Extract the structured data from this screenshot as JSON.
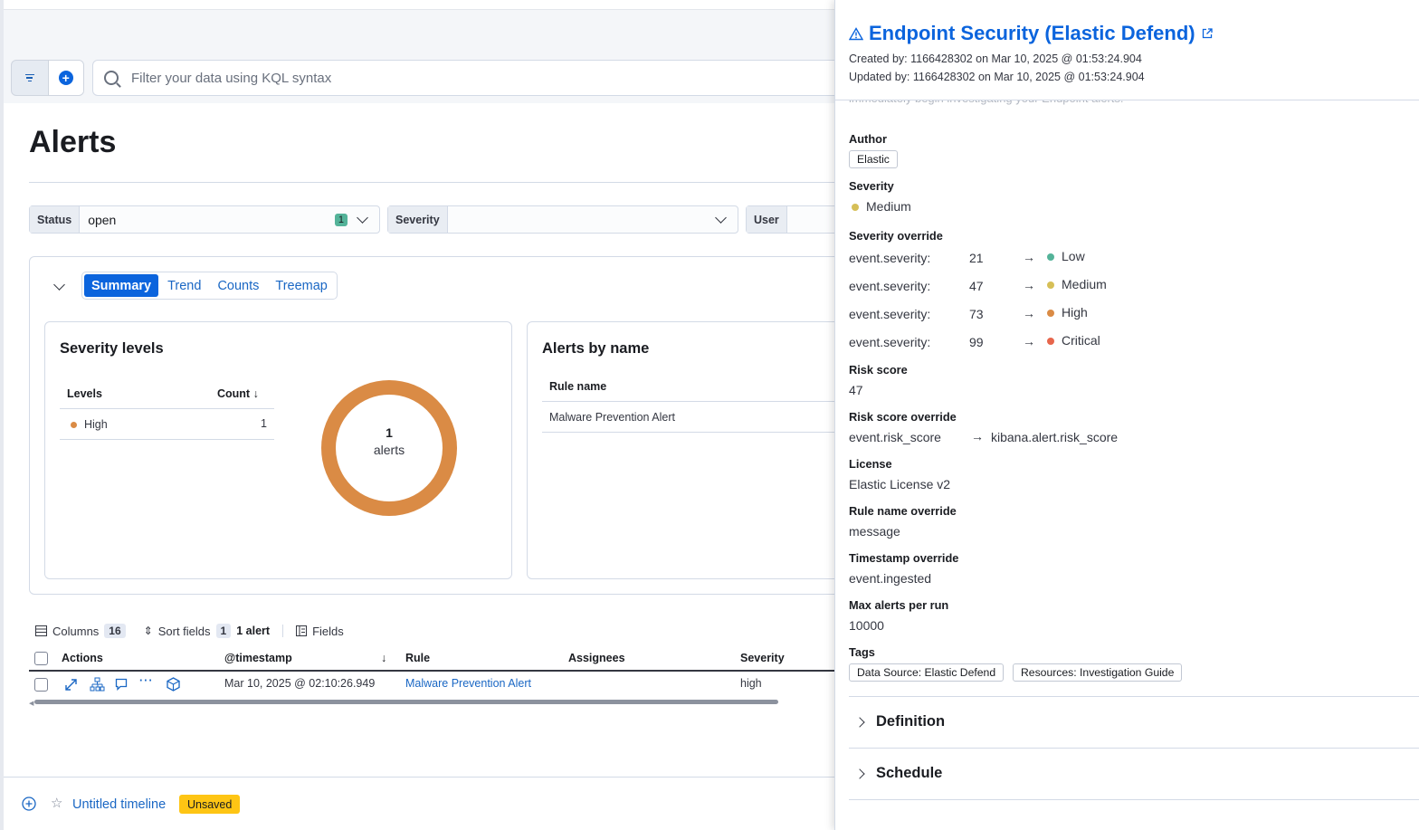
{
  "query": {
    "placeholder": "Filter your data using KQL syntax"
  },
  "page": {
    "title": "Alerts"
  },
  "controls": {
    "status": {
      "label": "Status",
      "value": "open",
      "count": "1"
    },
    "severity": {
      "label": "Severity",
      "value": ""
    },
    "user": {
      "label": "User"
    }
  },
  "tabs": [
    "Summary",
    "Trend",
    "Counts",
    "Treemap"
  ],
  "severity_card": {
    "title": "Severity levels",
    "col_levels": "Levels",
    "col_count": "Count",
    "rows": [
      {
        "level": "High",
        "count": "1",
        "color": "#da8b45"
      }
    ],
    "donut_value": "1",
    "donut_label": "alerts",
    "donut_color": "#da8b45"
  },
  "alerts_by_name": {
    "title": "Alerts by name",
    "col_rule": "Rule name",
    "rows": [
      "Malware Prevention Alert"
    ]
  },
  "table": {
    "columns_label": "Columns",
    "columns_count": "16",
    "sort_label": "Sort fields",
    "sort_count": "1",
    "alert_count": "1 alert",
    "fields_label": "Fields",
    "headers": {
      "actions": "Actions",
      "timestamp": "@timestamp",
      "rule": "Rule",
      "assignees": "Assignees",
      "severity": "Severity"
    },
    "row": {
      "timestamp": "Mar 10, 2025 @ 02:10:26.949",
      "rule": "Malware Prevention Alert",
      "severity": "high"
    }
  },
  "timeline": {
    "title": "Untitled timeline",
    "badge": "Unsaved"
  },
  "flyout": {
    "title": "Endpoint Security (Elastic Defend)",
    "created": "Created by: 1166428302 on Mar 10, 2025 @ 01:53:24.904",
    "updated": "Updated by: 1166428302 on Mar 10, 2025 @ 01:53:24.904",
    "clipped_text": "immediately begin investigating your Endpoint alerts.",
    "author_label": "Author",
    "author": "Elastic",
    "severity_label": "Severity",
    "severity": "Medium",
    "severity_override_label": "Severity override",
    "overrides": [
      {
        "field": "event.severity:",
        "value": "21",
        "level": "Low",
        "color": "#54b399"
      },
      {
        "field": "event.severity:",
        "value": "47",
        "level": "Medium",
        "color": "#d6bf57"
      },
      {
        "field": "event.severity:",
        "value": "73",
        "level": "High",
        "color": "#da8b45"
      },
      {
        "field": "event.severity:",
        "value": "99",
        "level": "Critical",
        "color": "#e7664c"
      }
    ],
    "risk_label": "Risk score",
    "risk": "47",
    "risk_override_label": "Risk score override",
    "risk_override_from": "event.risk_score",
    "risk_override_to": "kibana.alert.risk_score",
    "license_label": "License",
    "license": "Elastic License v2",
    "rule_name_override_label": "Rule name override",
    "rule_name_override": "message",
    "timestamp_override_label": "Timestamp override",
    "timestamp_override": "event.ingested",
    "max_alerts_label": "Max alerts per run",
    "max_alerts": "10000",
    "tags_label": "Tags",
    "tags": [
      "Data Source: Elastic Defend",
      "Resources: Investigation Guide"
    ],
    "sections": [
      "Definition",
      "Schedule"
    ]
  }
}
